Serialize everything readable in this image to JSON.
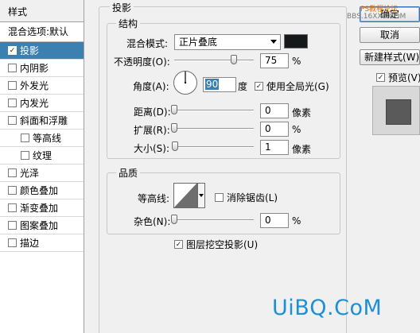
{
  "left": {
    "title": "样式",
    "blend_options": "混合选项:默认",
    "items": [
      {
        "label": "投影",
        "checked": true,
        "active": true,
        "sub": false
      },
      {
        "label": "内阴影",
        "checked": false,
        "active": false,
        "sub": false
      },
      {
        "label": "外发光",
        "checked": false,
        "active": false,
        "sub": false
      },
      {
        "label": "内发光",
        "checked": false,
        "active": false,
        "sub": false
      },
      {
        "label": "斜面和浮雕",
        "checked": false,
        "active": false,
        "sub": false
      },
      {
        "label": "等高线",
        "checked": false,
        "active": false,
        "sub": true
      },
      {
        "label": "纹理",
        "checked": false,
        "active": false,
        "sub": true
      },
      {
        "label": "光泽",
        "checked": false,
        "active": false,
        "sub": false
      },
      {
        "label": "颜色叠加",
        "checked": false,
        "active": false,
        "sub": false
      },
      {
        "label": "渐变叠加",
        "checked": false,
        "active": false,
        "sub": false
      },
      {
        "label": "图案叠加",
        "checked": false,
        "active": false,
        "sub": false
      },
      {
        "label": "描边",
        "checked": false,
        "active": false,
        "sub": false
      }
    ]
  },
  "main": {
    "section_title": "投影",
    "structure": {
      "title": "结构",
      "blend_mode_label": "混合模式:",
      "blend_mode_value": "正片叠底",
      "shadow_color": "#151919",
      "opacity_label": "不透明度(O):",
      "opacity_value": "75",
      "opacity_fraction": 0.75,
      "opacity_unit": "%",
      "angle_label": "角度(A):",
      "angle_value": "90",
      "angle_unit": "度",
      "global_light_label": "使用全局光(G)",
      "global_light_checked": true,
      "distance_label": "距离(D):",
      "distance_value": "0",
      "distance_unit": "像素",
      "spread_label": "扩展(R):",
      "spread_value": "0",
      "spread_unit": "%",
      "size_label": "大小(S):",
      "size_value": "1",
      "size_unit": "像素"
    },
    "quality": {
      "title": "品质",
      "contour_label": "等高线:",
      "antialias_label": "消除锯齿(L)",
      "antialias_checked": false,
      "noise_label": "杂色(N):",
      "noise_value": "0",
      "noise_unit": "%"
    },
    "knockout_label": "图层挖空投影(U)",
    "knockout_checked": true
  },
  "right": {
    "ok_label": "确定",
    "cancel_label": "取消",
    "new_style_label": "新建样式(W)...",
    "preview_label": "预览(V)",
    "preview_checked": true
  },
  "watermarks": {
    "top": "PS教程论坛",
    "top2": "BBS.16XX8.COM",
    "bottom": "UiBQ.CoM"
  }
}
